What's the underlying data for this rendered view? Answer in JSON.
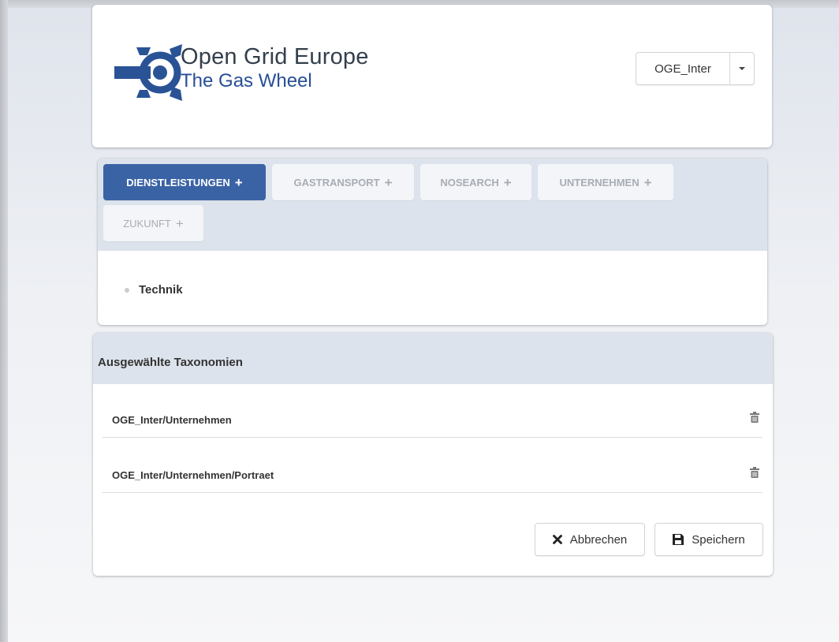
{
  "header": {
    "logo_title": "Open Grid Europe",
    "logo_subtitle": "The Gas Wheel",
    "account_selector": {
      "value": "OGE_Inter"
    }
  },
  "categories": {
    "tabs": [
      {
        "label": "DIENSTLEISTUNGEN",
        "active": true
      },
      {
        "label": "GASTRANSPORT",
        "active": false
      },
      {
        "label": "NOSEARCH",
        "active": false
      },
      {
        "label": "UNTERNEHMEN",
        "active": false
      },
      {
        "label": "ZUKUNFT",
        "active": false
      }
    ],
    "plus_symbol": "+",
    "items": [
      {
        "label": "Technik"
      }
    ]
  },
  "selected_taxonomies": {
    "title": "Ausgewählte Taxonomien",
    "items": [
      {
        "path": "OGE_Inter/Unternehmen"
      },
      {
        "path": "OGE_Inter/Unternehmen/Portraet"
      }
    ],
    "cancel_label": "Abbrechen",
    "save_label": "Speichern"
  },
  "colors": {
    "accent": "#3a63a6",
    "panel_header": "#dde3ec",
    "logo_blue": "#274f96"
  },
  "icons": {
    "logo": "gas-wheel-logo-icon",
    "dropdown": "caret-down-icon",
    "tab_add": "plus-icon",
    "bullet": "bullet-icon",
    "delete": "trash-icon",
    "cancel": "close-icon",
    "save": "floppy-disk-icon"
  }
}
